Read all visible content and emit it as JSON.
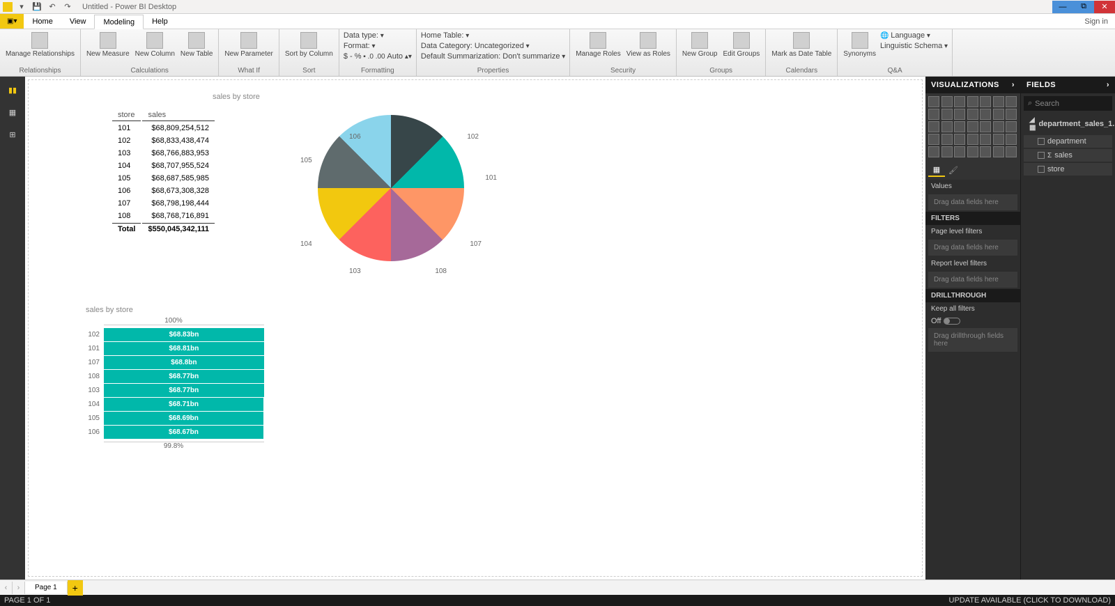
{
  "title": "Untitled - Power BI Desktop",
  "signin": "Sign in",
  "menu": {
    "file": "File",
    "tabs": [
      "Home",
      "View",
      "Modeling",
      "Help"
    ],
    "active": "Modeling"
  },
  "ribbon": {
    "relationships": {
      "btn": "Manage\nRelationships",
      "label": "Relationships"
    },
    "calculations": {
      "btns": [
        "New\nMeasure",
        "New\nColumn",
        "New\nTable"
      ],
      "label": "Calculations"
    },
    "whatif": {
      "btn": "New\nParameter",
      "label": "What If"
    },
    "sort": {
      "btn": "Sort by\nColumn",
      "label": "Sort"
    },
    "formatting": {
      "datatype": "Data type:",
      "format": "Format:",
      "currency": "$ - %",
      "auto": "Auto",
      "label": "Formatting"
    },
    "properties": {
      "hometable": "Home Table:",
      "datacat": "Data Category: Uncategorized",
      "summ": "Default Summarization: Don't summarize",
      "label": "Properties"
    },
    "security": {
      "btns": [
        "Manage\nRoles",
        "View as\nRoles"
      ],
      "label": "Security"
    },
    "groups": {
      "btns": [
        "New\nGroup",
        "Edit\nGroups"
      ],
      "label": "Groups"
    },
    "calendars": {
      "btn": "Mark as\nDate Table",
      "label": "Calendars"
    },
    "qa": {
      "syn": "Synonyms",
      "lang": "Language",
      "ling": "Linguistic Schema",
      "label": "Q&A"
    }
  },
  "vispanel": {
    "title": "VISUALIZATIONS",
    "values": "Values",
    "drag": "Drag data fields here",
    "filters": "FILTERS",
    "pagefilters": "Page level filters",
    "reportfilters": "Report level filters",
    "drillthrough": "DRILLTHROUGH",
    "keepfilters": "Keep all filters",
    "off": "Off",
    "dragdrill": "Drag drillthrough fields here"
  },
  "fieldspanel": {
    "title": "FIELDS",
    "search": "Search",
    "table": "department_sales_1...",
    "cols": [
      "department",
      "sales",
      "store"
    ]
  },
  "pagetab": "Page 1",
  "status": {
    "left": "PAGE 1 OF 1",
    "right": "UPDATE AVAILABLE (CLICK TO DOWNLOAD)"
  },
  "chart_data": [
    {
      "type": "table",
      "title": "sales by store",
      "columns": [
        "store",
        "sales"
      ],
      "rows": [
        [
          "101",
          "$68,809,254,512"
        ],
        [
          "102",
          "$68,833,438,474"
        ],
        [
          "103",
          "$68,766,883,953"
        ],
        [
          "104",
          "$68,707,955,524"
        ],
        [
          "105",
          "$68,687,585,985"
        ],
        [
          "106",
          "$68,673,308,328"
        ],
        [
          "107",
          "$68,798,198,444"
        ],
        [
          "108",
          "$68,768,716,891"
        ]
      ],
      "total": [
        "Total",
        "$550,045,342,111"
      ]
    },
    {
      "type": "pie",
      "title": "sales by store",
      "categories": [
        "101",
        "102",
        "103",
        "104",
        "105",
        "106",
        "107",
        "108"
      ],
      "values": [
        68809254512,
        68833438474,
        68766883953,
        68707955524,
        68687585985,
        68673308328,
        68798198444,
        68768716891
      ],
      "colors": [
        "#01b8aa",
        "#374649",
        "#fd625e",
        "#f2c80f",
        "#5f6b6d",
        "#8ad4eb",
        "#fe9666",
        "#a66999"
      ]
    },
    {
      "type": "bar",
      "title": "sales by store",
      "xlabel_top": "100%",
      "xlabel_bottom": "99.8%",
      "xlim": [
        0.998,
        1.0
      ],
      "series": [
        {
          "name": "sales",
          "values_label": [
            "$68.83bn",
            "$68.81bn",
            "$68.8bn",
            "$68.77bn",
            "$68.77bn",
            "$68.71bn",
            "$68.69bn",
            "$68.67bn"
          ],
          "values": [
            68.83,
            68.81,
            68.8,
            68.77,
            68.77,
            68.71,
            68.69,
            68.67
          ]
        }
      ],
      "categories": [
        "102",
        "101",
        "107",
        "108",
        "103",
        "104",
        "105",
        "106"
      ]
    }
  ]
}
